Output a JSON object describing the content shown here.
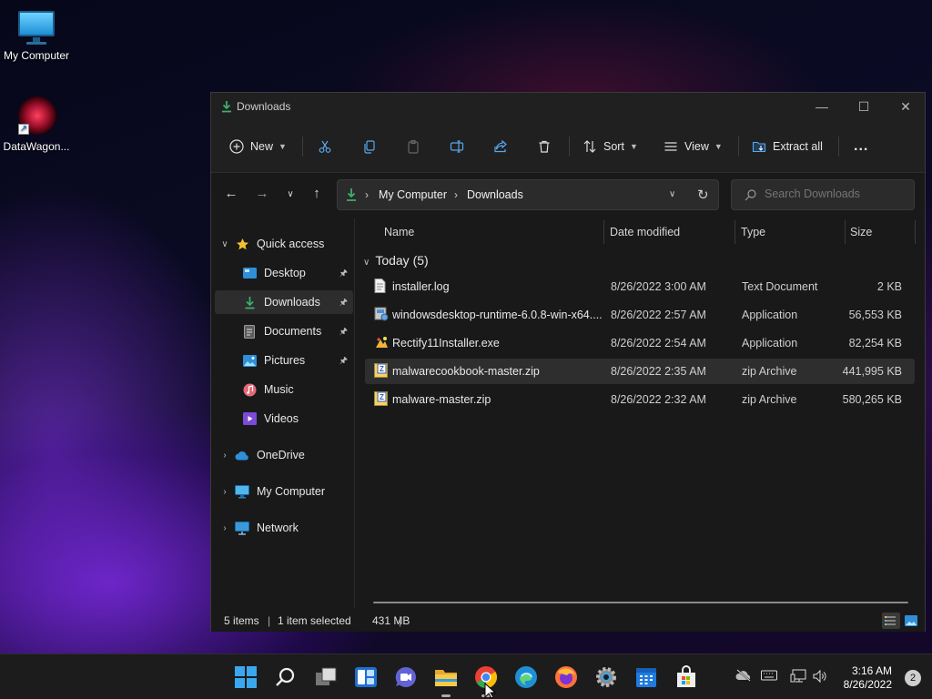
{
  "desktop": {
    "icons": [
      {
        "label": "My Computer",
        "icon": "monitor-icon"
      },
      {
        "label": "DataWagon...",
        "icon": "datawagon-icon"
      }
    ]
  },
  "window": {
    "title": "Downloads",
    "toolbar": {
      "new_label": "New",
      "sort_label": "Sort",
      "view_label": "View",
      "extract_label": "Extract all",
      "more_label": "..."
    },
    "address": {
      "crumbs": [
        "My Computer",
        "Downloads"
      ],
      "separator": "›"
    },
    "search": {
      "placeholder": "Search Downloads"
    },
    "nav": {
      "quick_access": "Quick access",
      "items": [
        {
          "label": "Desktop",
          "pinned": true
        },
        {
          "label": "Downloads",
          "pinned": true,
          "selected": true
        },
        {
          "label": "Documents",
          "pinned": true
        },
        {
          "label": "Pictures",
          "pinned": true
        },
        {
          "label": "Music",
          "pinned": false
        },
        {
          "label": "Videos",
          "pinned": false
        }
      ],
      "roots": [
        "OneDrive",
        "My Computer",
        "Network"
      ]
    },
    "columns": {
      "name": "Name",
      "date": "Date modified",
      "type": "Type",
      "size": "Size"
    },
    "group": "Today (5)",
    "files": [
      {
        "name": "installer.log",
        "date": "8/26/2022 3:00 AM",
        "type": "Text Document",
        "size": "2 KB",
        "icon": "text-file-icon"
      },
      {
        "name": "windowsdesktop-runtime-6.0.8-win-x64....",
        "date": "8/26/2022 2:57 AM",
        "type": "Application",
        "size": "56,553 KB",
        "icon": "installer-icon"
      },
      {
        "name": "Rectify11Installer.exe",
        "date": "8/26/2022 2:54 AM",
        "type": "Application",
        "size": "82,254 KB",
        "icon": "app-icon"
      },
      {
        "name": "malwarecookbook-master.zip",
        "date": "8/26/2022 2:35 AM",
        "type": "zip Archive",
        "size": "441,995 KB",
        "icon": "zip-icon",
        "selected": true
      },
      {
        "name": "malware-master.zip",
        "date": "8/26/2022 2:32 AM",
        "type": "zip Archive",
        "size": "580,265 KB",
        "icon": "zip-icon"
      }
    ],
    "status": {
      "items": "5 items",
      "selected": "1 item selected",
      "size": "431 MB",
      "divider": "|"
    }
  },
  "taskbar": {
    "clock_time": "3:16 AM",
    "clock_date": "8/26/2022",
    "notifications": "2"
  },
  "colors": {
    "accent": "#0078d4",
    "folder_green": "#3fae6a",
    "window_bg": "#191919"
  }
}
